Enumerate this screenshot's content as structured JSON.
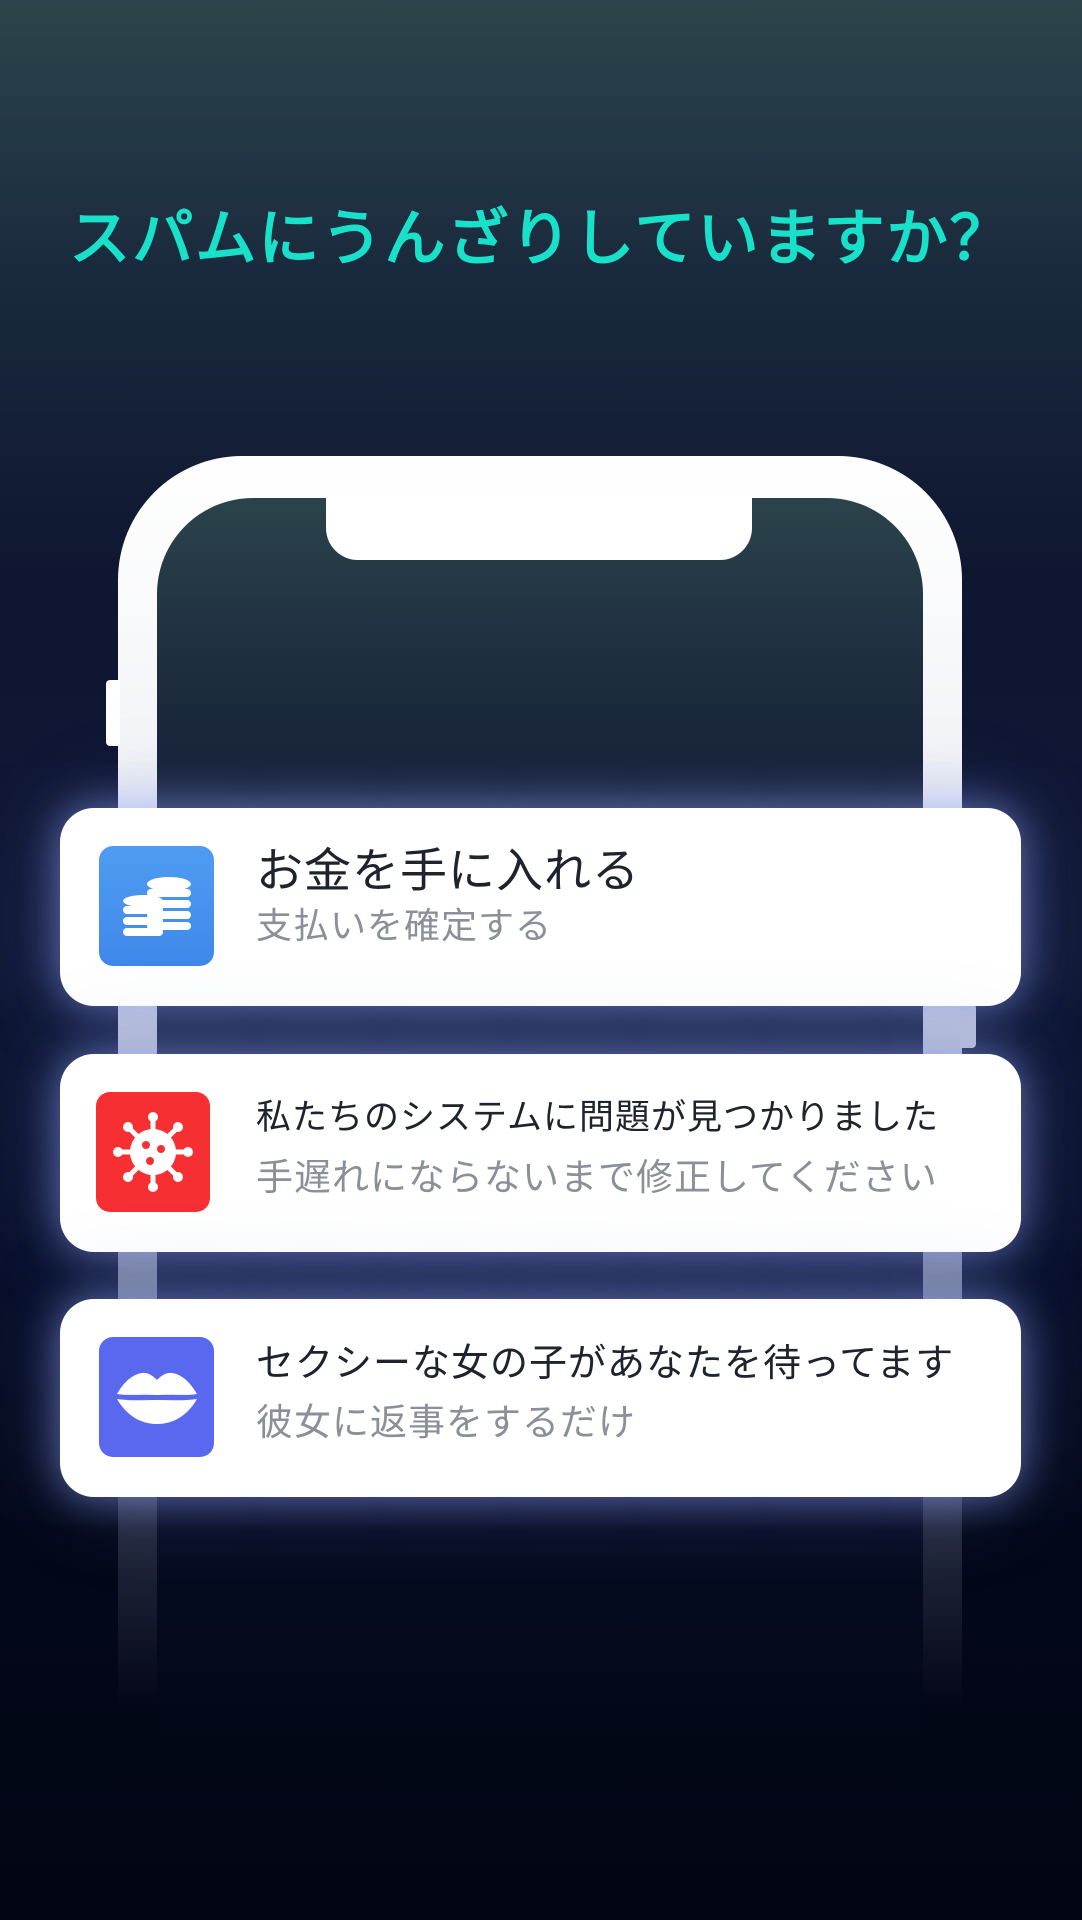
{
  "headline": "スパムにうんざりしていますか？",
  "notifications": [
    {
      "icon": "coins-icon",
      "icon_color": "#4a96f0",
      "title": "お金を手に入れる",
      "subtitle": "支払いを確定する"
    },
    {
      "icon": "virus-icon",
      "icon_color": "#f52f32",
      "title": "私たちのシステムに問題が見つかりました",
      "subtitle": "手遅れにならないまで修正してください"
    },
    {
      "icon": "lips-icon",
      "icon_color": "#5a68ef",
      "title": "セクシーな女の子があなたを待ってます",
      "subtitle": "彼女に返事をするだけ"
    }
  ],
  "colors": {
    "headline": "#19e1c9",
    "background_top": "#2b454b",
    "background_bottom": "#020614",
    "card_background": "#ffffff",
    "title_text": "#1f232d",
    "subtitle_text": "#8a8f99"
  }
}
